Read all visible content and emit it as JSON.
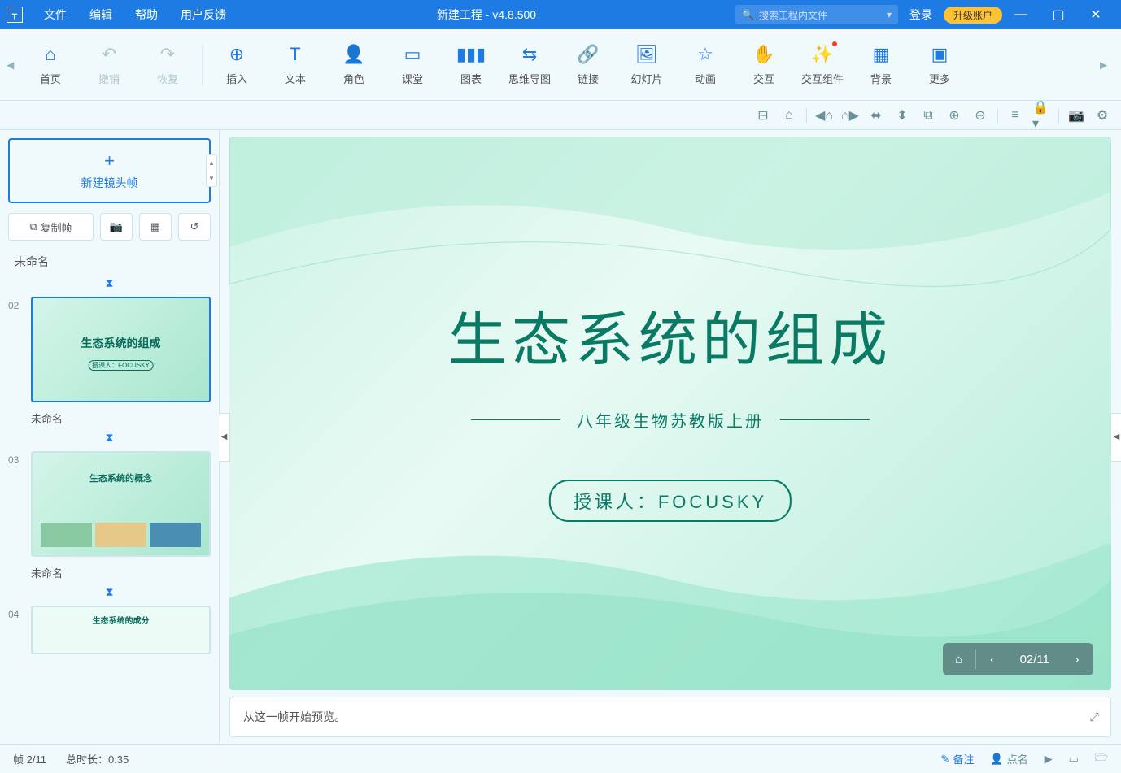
{
  "titlebar": {
    "menus": [
      "文件",
      "编辑",
      "帮助",
      "用户反馈"
    ],
    "title": "新建工程 - v4.8.500",
    "search_placeholder": "搜索工程内文件",
    "login": "登录",
    "upgrade": "升级账户"
  },
  "toolbar": {
    "home": "首页",
    "undo": "撤销",
    "redo": "恢复",
    "insert": "插入",
    "text": "文本",
    "role": "角色",
    "class": "课堂",
    "chart": "图表",
    "mindmap": "思维导图",
    "link": "链接",
    "slide": "幻灯片",
    "anim": "动画",
    "interact": "交互",
    "widget": "交互组件",
    "bg": "背景",
    "more": "更多"
  },
  "sidebar": {
    "new_frame": "新建镜头帧",
    "copy_frame": "复制帧",
    "section": "未命名",
    "slides": [
      {
        "num": "02",
        "name": "未命名",
        "title": "生态系统的组成",
        "sub": "授课人：FOCUSKY"
      },
      {
        "num": "03",
        "name": "未命名",
        "title": "生态系统的概念",
        "sub": ""
      },
      {
        "num": "04",
        "name": "",
        "title": "生态系统的成分",
        "sub": ""
      }
    ]
  },
  "canvas": {
    "title": "生态系统的组成",
    "subtitle": "八年级生物苏教版上册",
    "author": "授课人：FOCUSKY",
    "page_indicator": "02/11"
  },
  "preview": {
    "text": "从这一帧开始预览。"
  },
  "status": {
    "frame": "帧 2/11",
    "duration": "总时长：0:35",
    "note": "备注",
    "roll": "点名"
  }
}
